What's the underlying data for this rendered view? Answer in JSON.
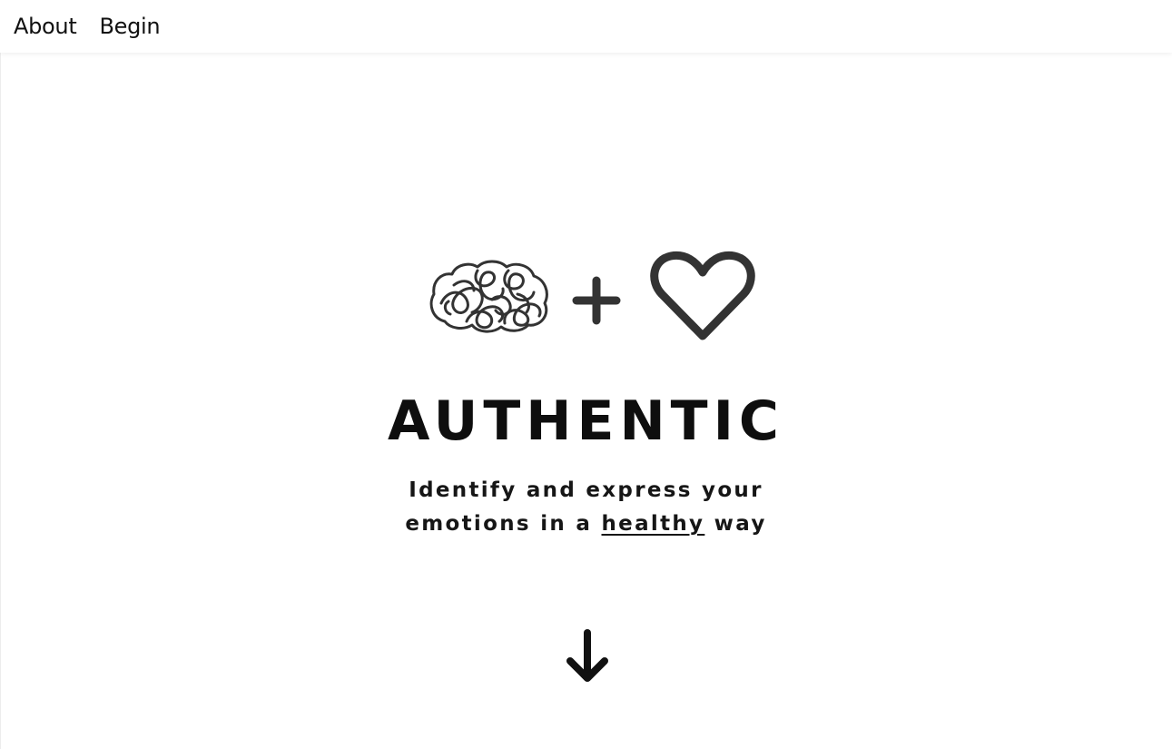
{
  "nav": {
    "items": [
      {
        "label": "About"
      },
      {
        "label": "Begin"
      }
    ]
  },
  "hero": {
    "icons": [
      "brain-icon",
      "plus-icon",
      "heart-icon"
    ],
    "title": "AUTHENTIC",
    "tagline": {
      "line1": "Identify and express your",
      "line2_before": "emotions in a",
      "line2_highlight": "healthy",
      "line2_after": "way"
    },
    "scroll_icon": "arrow-down-icon"
  },
  "colors": {
    "text": "#111111",
    "icon": "#333333",
    "background": "#ffffff"
  }
}
